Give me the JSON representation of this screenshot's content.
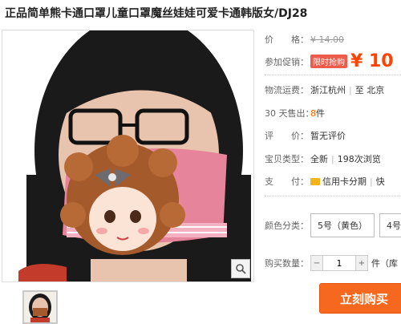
{
  "product": {
    "title": "正品简单熊卡通口罩儿童口罩魔丝娃娃可爱卡通韩版女/DJ28"
  },
  "gallery": {
    "main_image_alt": "product photo",
    "thumb_alt": "thumbnail"
  },
  "info": {
    "price_label": "价　　格：",
    "original_price": "¥ 14.00",
    "promo_label": "参加促销：",
    "promo_badge": "限时抢购",
    "promo_price": "¥ 10",
    "shipping_label": "物流运费：",
    "shipping_from": "浙江杭州",
    "shipping_to": "至 北京",
    "sold_label": "30 天售出：",
    "sold_count": "8",
    "sold_unit": "件",
    "rating_label": "评　　价：",
    "rating_value": "暂无评价",
    "type_label": "宝贝类型：",
    "type_value": "全新",
    "views_value": "198次浏览",
    "pay_label": "支　　付：",
    "pay_credit": "信用卡分期",
    "pay_quick": "快"
  },
  "options": {
    "color_label": "颜色分类：",
    "color_selected": "5号（黄色）",
    "color_next": "4号",
    "qty_label": "购买数量：",
    "qty_value": "1",
    "qty_unit": "件（库"
  },
  "actions": {
    "buy_now": "立刻购买"
  },
  "colors": {
    "price": "#ff4400",
    "badge": "#ef5b4a",
    "buy_button": "#f6681d"
  }
}
